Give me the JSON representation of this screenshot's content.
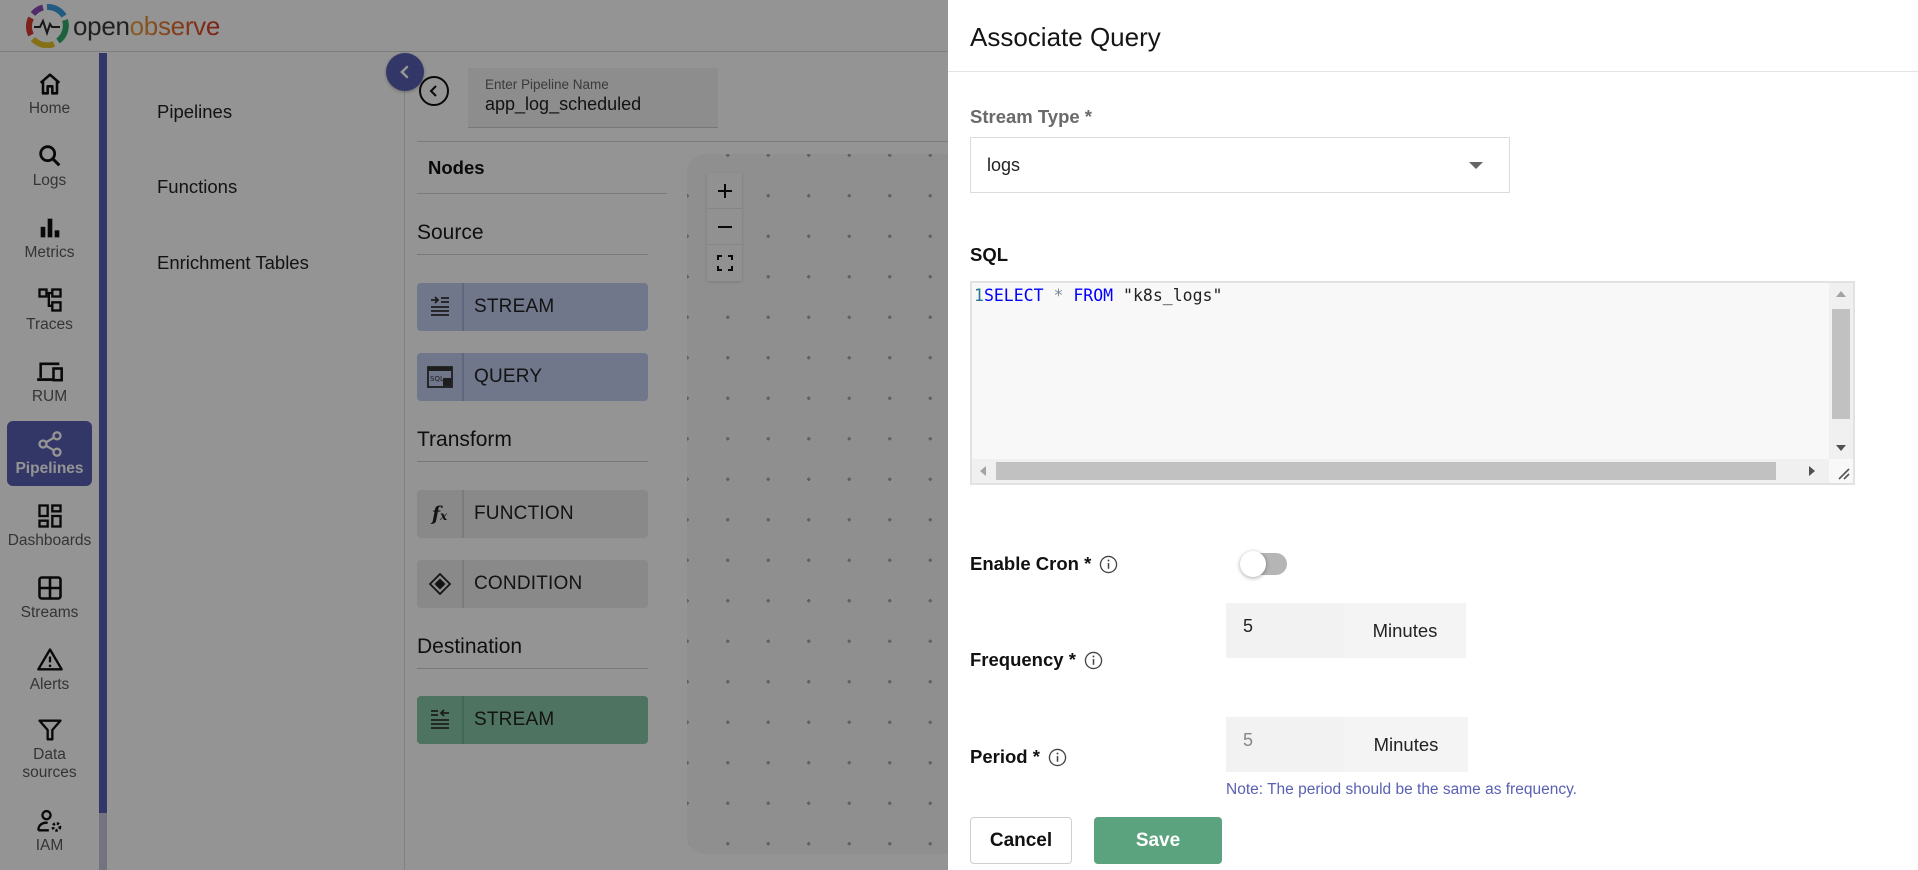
{
  "brand": {
    "name_part1": "open",
    "name_part2": "observe"
  },
  "leftnav": {
    "items": [
      {
        "label": "Home",
        "icon": "home-icon",
        "active": false
      },
      {
        "label": "Logs",
        "icon": "search-icon",
        "active": false
      },
      {
        "label": "Metrics",
        "icon": "bar-chart-icon",
        "active": false
      },
      {
        "label": "Traces",
        "icon": "trace-tree-icon",
        "active": false
      },
      {
        "label": "RUM",
        "icon": "devices-icon",
        "active": false
      },
      {
        "label": "Pipelines",
        "icon": "share-nodes-icon",
        "active": true
      },
      {
        "label": "Dashboards",
        "icon": "dashboard-icon",
        "active": false
      },
      {
        "label": "Streams",
        "icon": "grid-icon",
        "active": false
      },
      {
        "label": "Alerts",
        "icon": "warning-icon",
        "active": false
      },
      {
        "label": "Data sources",
        "icon": "filter-icon",
        "active": false
      },
      {
        "label": "IAM",
        "icon": "user-settings-icon",
        "active": false
      }
    ],
    "accent_color": "#5960b2"
  },
  "submenu": {
    "items": [
      {
        "label": "Pipelines"
      },
      {
        "label": "Functions"
      },
      {
        "label": "Enrichment Tables"
      }
    ]
  },
  "pipeline_editor": {
    "name_field": {
      "label": "Enter Pipeline Name",
      "value": "app_log_scheduled"
    },
    "nodes_title": "Nodes",
    "sections": {
      "source": {
        "title": "Source",
        "nodes": [
          {
            "label": "STREAM",
            "icon": "stream-input-icon"
          },
          {
            "label": "QUERY",
            "icon": "sql-query-icon"
          }
        ]
      },
      "transform": {
        "title": "Transform",
        "nodes": [
          {
            "label": "FUNCTION",
            "icon": "function-fx-icon"
          },
          {
            "label": "CONDITION",
            "icon": "condition-diamond-icon"
          }
        ]
      },
      "destination": {
        "title": "Destination",
        "nodes": [
          {
            "label": "STREAM",
            "icon": "stream-output-icon"
          }
        ]
      }
    },
    "canvas_controls": [
      "zoom-in",
      "zoom-out",
      "fit-view"
    ]
  },
  "drawer": {
    "title": "Associate Query",
    "stream_type": {
      "label": "Stream Type *",
      "value": "logs"
    },
    "sql": {
      "label": "SQL",
      "line_number": "1",
      "tokens": {
        "kw1": "SELECT",
        "op": "*",
        "kw2": "FROM",
        "str": "\"k8s_logs\""
      }
    },
    "enable_cron": {
      "label": "Enable Cron *",
      "enabled": false
    },
    "frequency": {
      "label": "Frequency *",
      "value": "5",
      "unit": "Minutes"
    },
    "period": {
      "label": "Period *",
      "value": "5",
      "unit": "Minutes"
    },
    "note": "Note: The period should be the same as frequency.",
    "buttons": {
      "cancel": "Cancel",
      "save": "Save"
    },
    "colors": {
      "save": "#5ba37e",
      "note": "#5960b2"
    }
  }
}
